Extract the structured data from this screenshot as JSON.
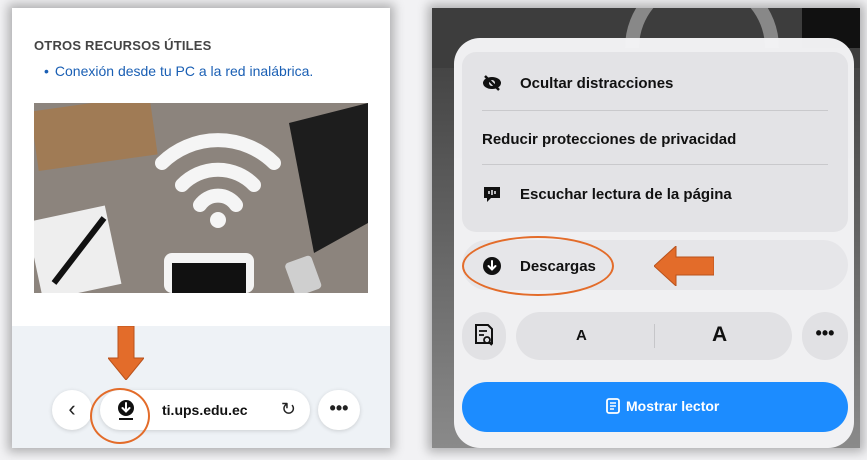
{
  "left": {
    "section_title": "OTROS RECURSOS ÚTILES",
    "link_text": "Conexión desde tu PC a la red inalábrica.",
    "toolbar": {
      "url": "ti.ups.edu.ec",
      "back_icon": "chevron-left-icon",
      "download_icon": "download-icon",
      "reload_icon": "reload-icon",
      "more_icon": "more-icon"
    }
  },
  "right": {
    "menu": {
      "hide_distractions": "Ocultar distracciones",
      "reduce_privacy": "Reducir protecciones de privacidad",
      "listen_page": "Escuchar lectura de la página",
      "downloads": "Descargas"
    },
    "font_small": "A",
    "font_big": "A",
    "more": "•••",
    "show_reader": "Mostrar lector"
  },
  "colors": {
    "accent_blue": "#1c8cff",
    "annotation_orange": "#e36c2a",
    "link_blue": "#1a5fb4"
  }
}
